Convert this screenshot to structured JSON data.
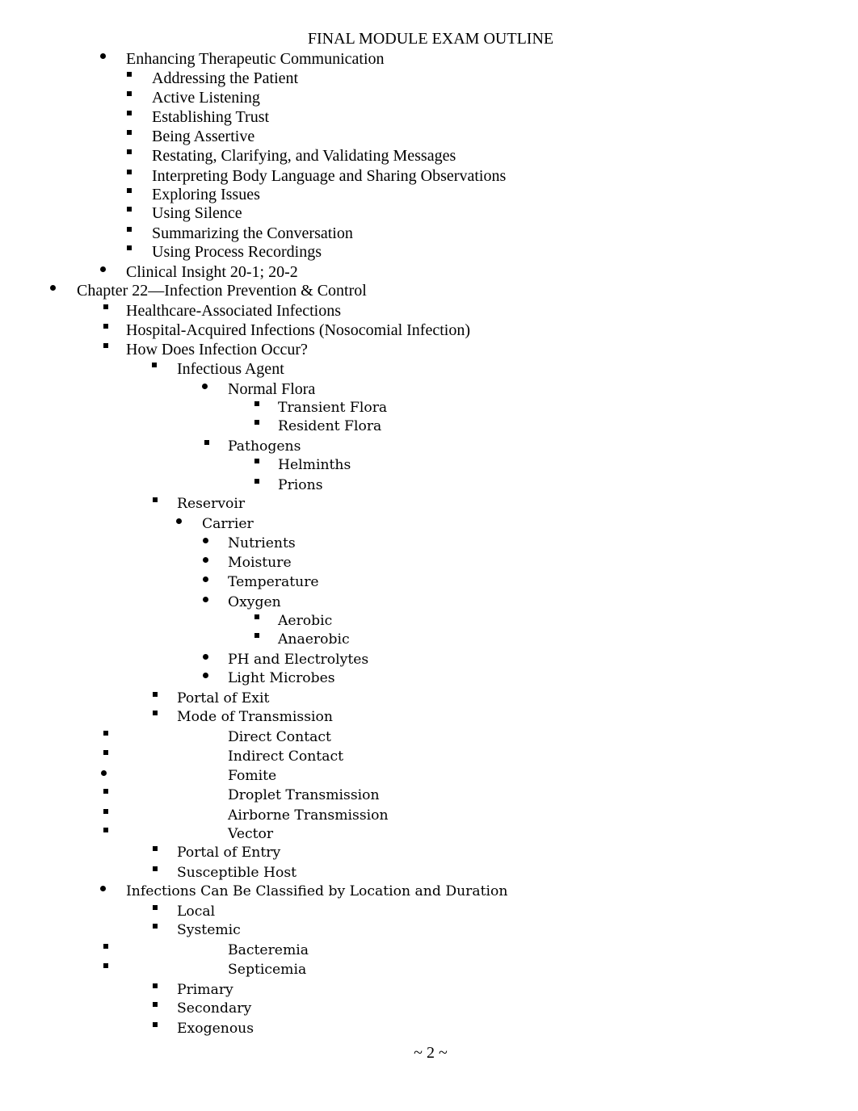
{
  "document": {
    "title": "FINAL MODULE EXAM OUTLINE",
    "page_footer": "~ 2 ~",
    "bullet_styles": {
      "dot": "filled-circle",
      "square": "filled-square"
    },
    "lines": [
      {
        "text": "Enhancing Therapeutic Communication",
        "bullet": "dot",
        "level": 2
      },
      {
        "text": "Addressing the Patient",
        "bullet": "square",
        "level": 3
      },
      {
        "text": "Active Listening",
        "bullet": "square",
        "level": 3
      },
      {
        "text": "Establishing Trust",
        "bullet": "square",
        "level": 3
      },
      {
        "text": "Being Assertive",
        "bullet": "square",
        "level": 3
      },
      {
        "text": "Restating, Clarifying, and Validating Messages",
        "bullet": "square",
        "level": 3
      },
      {
        "text": "Interpreting Body Language and Sharing Observations",
        "bullet": "square",
        "level": 3
      },
      {
        "text": "Exploring Issues",
        "bullet": "square",
        "level": 3
      },
      {
        "text": "Using Silence",
        "bullet": "square",
        "level": 3
      },
      {
        "text": "Summarizing the Conversation",
        "bullet": "square",
        "level": 3
      },
      {
        "text": "Using Process Recordings",
        "bullet": "square",
        "level": 3
      },
      {
        "text": "Clinical Insight 20-1; 20-2",
        "bullet": "dot",
        "level": 2
      },
      {
        "text": "Chapter 22—Infection Prevention & Control",
        "bullet": "dot",
        "level": 1
      },
      {
        "text": "Healthcare-Associated Infections",
        "bullet": "square",
        "level": 2
      },
      {
        "text": "Hospital-Acquired Infections (Nosocomial Infection)",
        "bullet": "square",
        "level": 2
      },
      {
        "text": "How Does Infection Occur?",
        "bullet": "square",
        "level": 2
      },
      {
        "text": "Infectious Agent",
        "bullet": "square",
        "level": 3
      },
      {
        "text": "Normal Flora",
        "bullet": "dot",
        "level": 4
      },
      {
        "text": "Transient Flora",
        "bullet": "square",
        "level": 5
      },
      {
        "text": "Resident Flora",
        "bullet": "square",
        "level": 5
      },
      {
        "text": "Pathogens",
        "bullet": "square",
        "level": 4
      },
      {
        "text": "Helminths",
        "bullet": "square",
        "level": 5
      },
      {
        "text": "Prions",
        "bullet": "square",
        "level": 5
      },
      {
        "text": "Reservoir",
        "bullet": "square",
        "level": 3
      },
      {
        "text": "Carrier",
        "bullet": "dot",
        "level": 3.5
      },
      {
        "text": "Nutrients",
        "bullet": "dot",
        "level": 4
      },
      {
        "text": "Moisture",
        "bullet": "dot",
        "level": 4
      },
      {
        "text": "Temperature",
        "bullet": "dot",
        "level": 4
      },
      {
        "text": "Oxygen",
        "bullet": "dot",
        "level": 4
      },
      {
        "text": "Aerobic",
        "bullet": "square",
        "level": 5
      },
      {
        "text": "Anaerobic",
        "bullet": "square",
        "level": 5
      },
      {
        "text": "PH and Electrolytes",
        "bullet": "dot",
        "level": 4
      },
      {
        "text": "Light Microbes",
        "bullet": "dot",
        "level": 4
      },
      {
        "text": "Portal of Exit",
        "bullet": "square",
        "level": 3
      },
      {
        "text": "Mode of Transmission",
        "bullet": "square",
        "level": 3
      },
      {
        "text": "Direct Contact",
        "bullet": "square",
        "level": "2/4"
      },
      {
        "text": "Indirect Contact",
        "bullet": "square",
        "level": "2/4"
      },
      {
        "text": "Fomite",
        "bullet": "dot",
        "level": "2/4"
      },
      {
        "text": "Droplet Transmission",
        "bullet": "square",
        "level": "2/4"
      },
      {
        "text": "Airborne Transmission",
        "bullet": "square",
        "level": "2/4"
      },
      {
        "text": "Vector",
        "bullet": "square",
        "level": "2/4"
      },
      {
        "text": "Portal of Entry",
        "bullet": "square",
        "level": 3
      },
      {
        "text": "Susceptible Host",
        "bullet": "square",
        "level": 3
      },
      {
        "text": "Infections Can Be Classified by Location and Duration",
        "bullet": "dot",
        "level": 2
      },
      {
        "text": "Local",
        "bullet": "square",
        "level": 3
      },
      {
        "text": "Systemic",
        "bullet": "square",
        "level": 3
      },
      {
        "text": "Bacteremia",
        "bullet": "square",
        "level": "2/4"
      },
      {
        "text": "Septicemia",
        "bullet": "square",
        "level": "2/4"
      },
      {
        "text": "Primary",
        "bullet": "square",
        "level": 3
      },
      {
        "text": "Secondary",
        "bullet": "square",
        "level": 3
      },
      {
        "text": "Exogenous",
        "bullet": "square",
        "level": 3
      }
    ]
  }
}
